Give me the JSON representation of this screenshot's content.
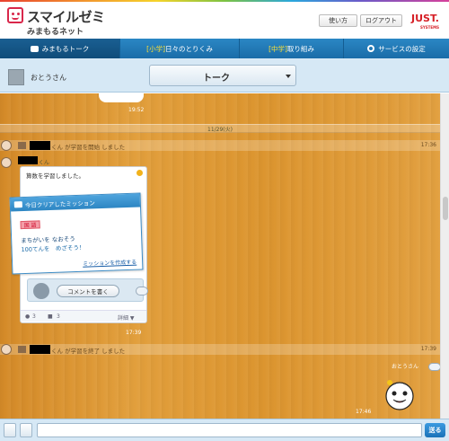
{
  "header": {
    "logo_main": "スマイルゼミ",
    "logo_sub": "みまもるネット",
    "usage_label": "使い方",
    "logout_label": "ログアウト",
    "brand": "JUST.",
    "brand_sub": "SYSTEMS"
  },
  "nav": {
    "items": [
      {
        "label": "みまもるトーク"
      },
      {
        "prefix": "[小学]",
        "label": "日々のとりくみ"
      },
      {
        "prefix": "[中学]",
        "label": "取り組み"
      },
      {
        "label": "サービスの設定"
      }
    ]
  },
  "talk": {
    "user_name": "おとうさん",
    "mode_label": "トーク"
  },
  "timeline": {
    "prev_time": "19:52",
    "date_divider": "11/29(火)",
    "start_text": "くん が学習を開始 しました",
    "start_time": "17:36",
    "child_suffix": "くん",
    "message": "算数を学習しました。",
    "mission_title": "今日クリアしたミッション",
    "mission_tag": "国 語",
    "mission_line1": "まちがいを なおそう",
    "mission_line2": "100てんを　めざそう！",
    "mission_link": "ミッションを作成する",
    "comment_button": "コメントを書く",
    "footer_count1": "3",
    "footer_count2": "3",
    "footer_detail": "詳細 ▼",
    "card_time": "17:39",
    "end_text": "くん が学習を終了 しました",
    "end_time": "17:39",
    "my_name": "おとうさん",
    "my_time": "17:46"
  },
  "composer": {
    "send_label": "送る"
  }
}
